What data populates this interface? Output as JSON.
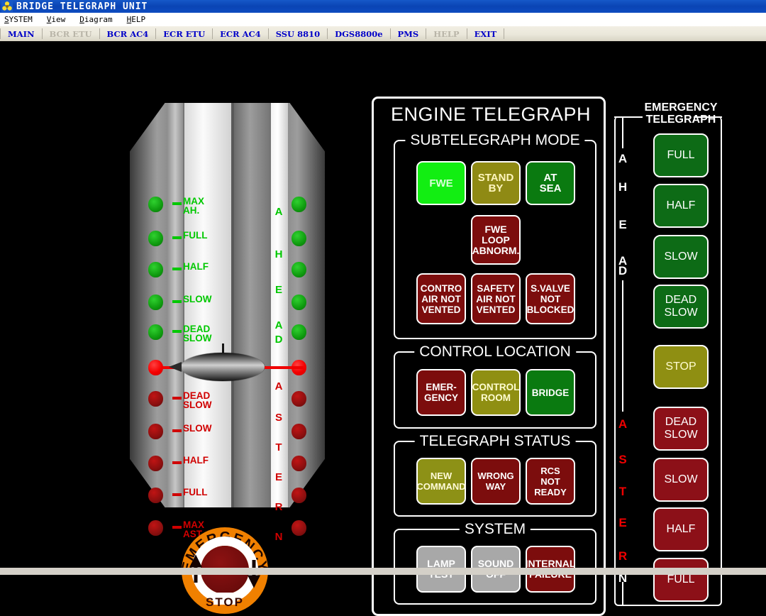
{
  "window": {
    "title": "BRIDGE TELEGRAPH UNIT",
    "icon": "propeller-icon"
  },
  "menubar": {
    "items": [
      {
        "label": "SYSTEM",
        "mnemonic": "S"
      },
      {
        "label": "View",
        "mnemonic": "V"
      },
      {
        "label": "Diagram",
        "mnemonic": "D"
      },
      {
        "label": "HELP",
        "mnemonic": "H"
      }
    ]
  },
  "tabbar": {
    "tabs": [
      {
        "label": "MAIN",
        "enabled": true,
        "active": true
      },
      {
        "label": "BCR ETU",
        "enabled": false,
        "active": false
      },
      {
        "label": "BCR AC4",
        "enabled": true,
        "active": false
      },
      {
        "label": "ECR ETU",
        "enabled": true,
        "active": false
      },
      {
        "label": "ECR AC4",
        "enabled": true,
        "active": false
      },
      {
        "label": "SSU 8810",
        "enabled": true,
        "active": false
      },
      {
        "label": "DGS8800e",
        "enabled": true,
        "active": false
      },
      {
        "label": "PMS",
        "enabled": true,
        "active": false
      },
      {
        "label": "HELP",
        "enabled": false,
        "active": false
      },
      {
        "label": "EXIT",
        "enabled": true,
        "active": false
      }
    ]
  },
  "telegraph": {
    "ahead_word": "AHEAD",
    "astern_word": "ASTERN",
    "ahead_letters": [
      "A",
      "H",
      "E",
      "A",
      "D"
    ],
    "astern_letters": [
      "A",
      "S",
      "T",
      "E",
      "R",
      "N"
    ],
    "ahead_steps": [
      {
        "label": "MAX\nAH.",
        "lit": false
      },
      {
        "label": "FULL",
        "lit": false
      },
      {
        "label": "HALF",
        "lit": false
      },
      {
        "label": "SLOW",
        "lit": false
      },
      {
        "label": "DEAD\nSLOW",
        "lit": false
      }
    ],
    "stop_step": {
      "label": "",
      "lit": true
    },
    "astern_steps": [
      {
        "label": "DEAD\nSLOW",
        "lit": false
      },
      {
        "label": "SLOW",
        "lit": false
      },
      {
        "label": "HALF",
        "lit": false
      },
      {
        "label": "FULL",
        "lit": false
      },
      {
        "label": "MAX\nAST.",
        "lit": false
      }
    ],
    "pointer_position": "STOP",
    "colors": {
      "ahead": "#00c800",
      "astern": "#d00000",
      "lit_red": "#ff0000"
    }
  },
  "emergency_stop": {
    "top_label": "EMERGENCY",
    "bottom_label": "STOP",
    "body_color": "#f08000",
    "button_color": "#6d0c0c"
  },
  "engine_telegraph": {
    "title": "ENGINE TELEGRAPH",
    "subtelegraph_mode": {
      "legend": "SUBTELEGRAPH MODE",
      "row1": [
        {
          "label": "FWE",
          "color": "#12ee12",
          "state": "active"
        },
        {
          "label": "STAND\nBY",
          "color": "#8f8a14",
          "state": "dim"
        },
        {
          "label": "AT\nSEA",
          "color": "#0a7a10",
          "state": "dim"
        }
      ],
      "row2": [
        {
          "label": "FWE\nLOOP\nABNORM.",
          "color": "#7c0d0d",
          "state": "dim"
        }
      ],
      "row3": [
        {
          "label": "CONTRO\nAIR NOT\nVENTED",
          "color": "#7c0d0d",
          "state": "dim"
        },
        {
          "label": "SAFETY\nAIR NOT\nVENTED",
          "color": "#7c0d0d",
          "state": "dim"
        },
        {
          "label": "S.VALVE\nNOT\nBLOCKED",
          "color": "#7c0d0d",
          "state": "dim"
        }
      ]
    },
    "control_location": {
      "legend": "CONTROL LOCATION",
      "buttons": [
        {
          "label": "EMER-\nGENCY",
          "color": "#7c0d0d",
          "state": "dim"
        },
        {
          "label": "CONTROL\nROOM",
          "color": "#8f8f12",
          "state": "dim"
        },
        {
          "label": "BRIDGE",
          "color": "#0a7a10",
          "state": "active"
        }
      ]
    },
    "telegraph_status": {
      "legend": "TELEGRAPH STATUS",
      "buttons": [
        {
          "label": "NEW\nCOMMAND",
          "color": "#8d9116",
          "state": "dim"
        },
        {
          "label": "WRONG\nWAY",
          "color": "#7c0d0d",
          "state": "dim"
        },
        {
          "label": "RCS\nNOT\nREADY",
          "color": "#7c0d0d",
          "state": "dim"
        }
      ]
    },
    "system": {
      "legend": "SYSTEM",
      "buttons": [
        {
          "label": "LAMP\nTEST",
          "color": "#a8a8a8",
          "state": "normal"
        },
        {
          "label": "SOUND\nOFF",
          "color": "#a8a8a8",
          "state": "normal"
        },
        {
          "label": "INTERNAL\nFAILURE",
          "color": "#7c0d0d",
          "state": "dim"
        }
      ]
    }
  },
  "emergency_telegraph": {
    "title": "EMERGENCY\nTELEGRAPH",
    "ahead_letters": [
      "A",
      "H",
      "E",
      "A",
      "D"
    ],
    "astern_letters": [
      "A",
      "S",
      "T",
      "E",
      "R",
      "N"
    ],
    "ahead_buttons": [
      {
        "label": "FULL",
        "color": "#0d6b16"
      },
      {
        "label": "HALF",
        "color": "#0d6b16"
      },
      {
        "label": "SLOW",
        "color": "#0d6b16"
      },
      {
        "label": "DEAD\nSLOW",
        "color": "#0d6b16"
      }
    ],
    "stop_button": {
      "label": "STOP",
      "color": "#8f8f12"
    },
    "astern_buttons": [
      {
        "label": "DEAD\nSLOW",
        "color": "#8c1018"
      },
      {
        "label": "SLOW",
        "color": "#8c1018"
      },
      {
        "label": "HALF",
        "color": "#8c1018"
      },
      {
        "label": "FULL",
        "color": "#8c1018"
      }
    ]
  }
}
